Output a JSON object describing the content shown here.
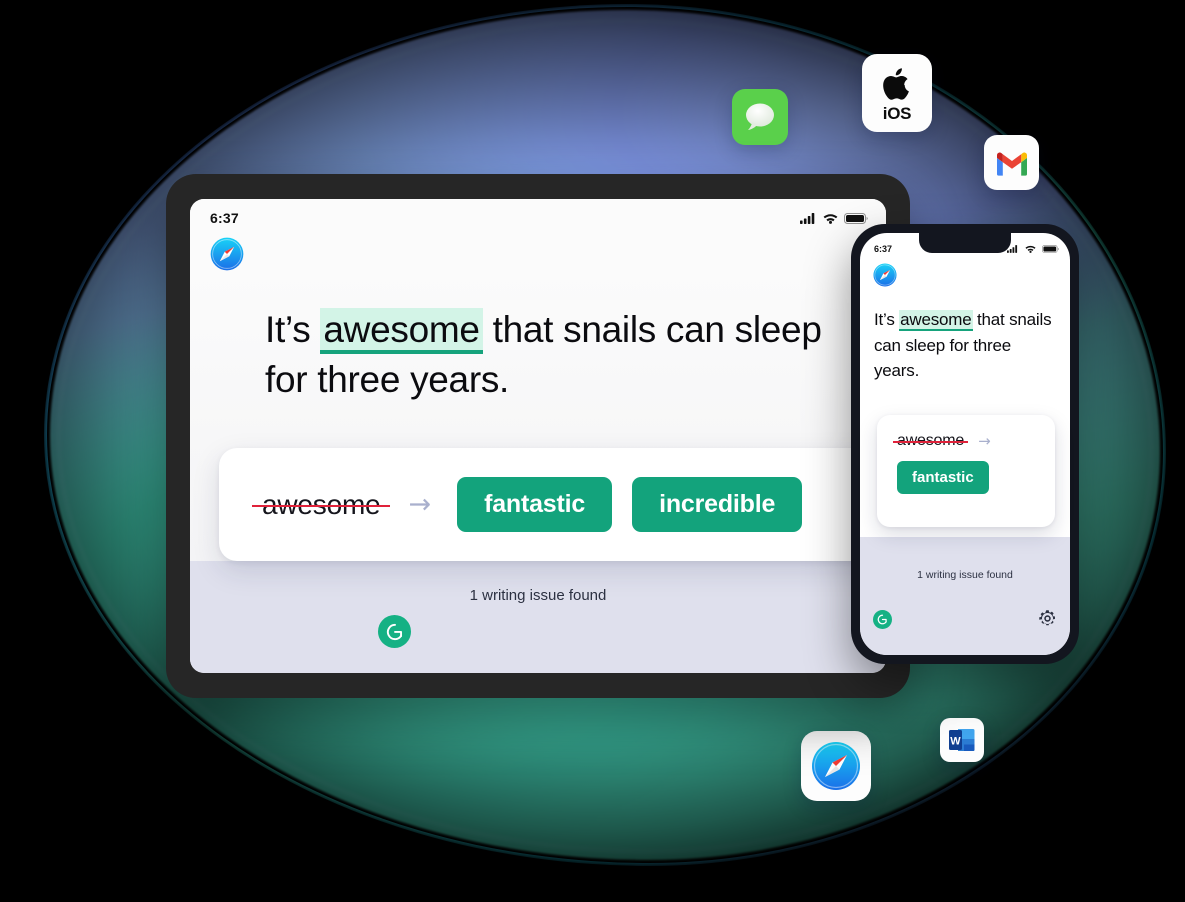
{
  "scene": {
    "title": "Grammarly on iOS devices",
    "background_color": "#000000",
    "blob_colors": {
      "top": "#8aa3ec",
      "bottom": "#3bbfa2",
      "ring": "#46ffd8"
    }
  },
  "app_icons": [
    {
      "name": "messages-app-icon",
      "label": "Messages",
      "color": "#5ad04b"
    },
    {
      "name": "ios-app-icon",
      "label": "iOS",
      "color": "#ffffff"
    },
    {
      "name": "gmail-app-icon",
      "label": "Gmail",
      "color": "#ffffff"
    },
    {
      "name": "safari-app-icon",
      "label": "Safari",
      "color": "#ffffff"
    },
    {
      "name": "word-app-icon",
      "label": "Word",
      "color": "#ffffff"
    }
  ],
  "ios_icon": {
    "label": "iOS"
  },
  "tablet": {
    "status_bar": {
      "time": "6:37",
      "icons": [
        "cellular-signal-icon",
        "wifi-icon",
        "battery-icon"
      ]
    },
    "browser_icon": "safari-icon",
    "document": {
      "before": "It’s ",
      "highlight": "awesome",
      "after": " that snails can sleep for three years."
    },
    "suggestion_card": {
      "original_word": "awesome",
      "arrow": "→",
      "suggestions": [
        "fantastic",
        "incredible"
      ],
      "button_color": "#13a37c"
    },
    "footer": {
      "issue_text": "1 writing issue found",
      "logo": "grammarly-logo",
      "background": "#dfe0ed"
    }
  },
  "phone": {
    "status_bar": {
      "time": "6:37",
      "icons": [
        "cellular-signal-icon",
        "wifi-icon",
        "battery-icon"
      ]
    },
    "browser_icon": "safari-icon",
    "document": {
      "before": "It’s ",
      "highlight": "awesome",
      "after": " that snails can sleep for three years."
    },
    "suggestion_card": {
      "original_word": "awesome",
      "arrow": "→",
      "suggestions": [
        "fantastic"
      ],
      "button_color": "#13a37c"
    },
    "footer": {
      "issue_text": "1 writing issue found",
      "logo": "grammarly-logo",
      "settings_icon": "gear-icon",
      "background": "#dfe0ed"
    }
  }
}
